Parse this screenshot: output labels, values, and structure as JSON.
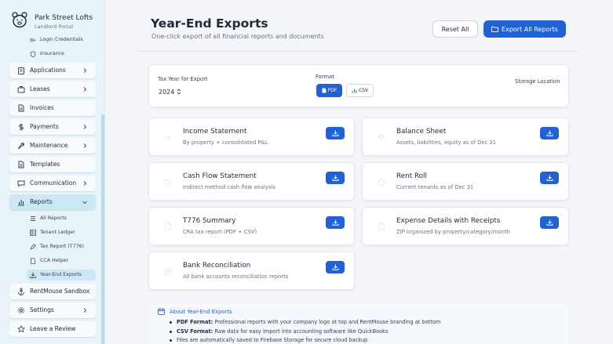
{
  "sidebar": {
    "brand": {
      "name": "Park Street Lofts",
      "subtitle": "Landlord Portal",
      "logo_icon": "bear-icon"
    },
    "partial_sub_items": [
      {
        "label": "Login Credentials",
        "icon": "key-icon"
      },
      {
        "label": "Insurance",
        "icon": "shield-icon"
      }
    ],
    "items": [
      {
        "label": "Applications",
        "icon": "clipboard-icon",
        "has_chevron": true
      },
      {
        "label": "Leases",
        "icon": "briefcase-icon",
        "has_chevron": true
      },
      {
        "label": "Invoices",
        "icon": "document-icon",
        "has_chevron": false
      },
      {
        "label": "Payments",
        "icon": "dollar-icon",
        "has_chevron": true
      },
      {
        "label": "Maintenance",
        "icon": "wrench-icon",
        "has_chevron": true
      },
      {
        "label": "Templates",
        "icon": "document-icon",
        "has_chevron": false
      },
      {
        "label": "Communication",
        "icon": "chat-icon",
        "has_chevron": true
      },
      {
        "label": "Reports",
        "icon": "bar-chart-icon",
        "has_chevron": true,
        "expanded": true
      }
    ],
    "report_sub_items": [
      {
        "label": "All Reports",
        "icon": "list-icon"
      },
      {
        "label": "Tenant Ledger",
        "icon": "grid-icon"
      },
      {
        "label": "Tax Report (T776)",
        "icon": "edit-icon"
      },
      {
        "label": "CCA Helper",
        "icon": "file-icon"
      },
      {
        "label": "Year-End Exports",
        "icon": "download-icon",
        "active": true
      }
    ],
    "bottom_items": [
      {
        "label": "RentMouse Sandbox",
        "icon": "anchor-icon",
        "has_chevron": false
      },
      {
        "label": "Settings",
        "icon": "gear-icon",
        "has_chevron": true
      },
      {
        "label": "Leave a Review",
        "icon": "star-icon",
        "has_chevron": false
      }
    ]
  },
  "header": {
    "title": "Year-End Exports",
    "subtitle": "One-click export of all financial reports and documents",
    "reset_label": "Reset All",
    "export_all_label": "Export All Reports"
  },
  "settings": {
    "tax_year_label": "Tax Year for Export",
    "tax_year_value": "2024",
    "format_label": "Format",
    "formats": [
      "PDF",
      "CSV"
    ],
    "selected_format": "PDF",
    "storage_label": "Storage Location"
  },
  "reports": [
    {
      "title": "Income Statement",
      "desc": "By property + consolidated P&L"
    },
    {
      "title": "Balance Sheet",
      "desc": "Assets, liabilities, equity as of Dec 31"
    },
    {
      "title": "Cash Flow Statement",
      "desc": "Indirect method cash flow analysis"
    },
    {
      "title": "Rent Roll",
      "desc": "Current tenants as of Dec 31"
    },
    {
      "title": "T776 Summary",
      "desc": "CRA tax report (PDF + CSV)"
    },
    {
      "title": "Expense Details with Receipts",
      "desc": "ZIP organized by property/category/month"
    },
    {
      "title": "Bank Reconciliation",
      "desc": "All bank accounts reconciliation reports"
    }
  ],
  "about": {
    "title": "About Year-End Exports",
    "points": [
      {
        "bold": "PDF Format:",
        "text": " Professional reports with your company logo at top and RentMouse branding at bottom"
      },
      {
        "bold": "CSV Format:",
        "text": " Raw data for easy import into accounting software like QuickBooks"
      },
      {
        "bold": "",
        "text": "Files are automatically saved to Firebase Storage for secure cloud backup"
      }
    ]
  },
  "colors": {
    "accent": "#1f62d6",
    "sidebar_bg": "#e8f4fa",
    "active_bg": "#cbe9f4"
  }
}
